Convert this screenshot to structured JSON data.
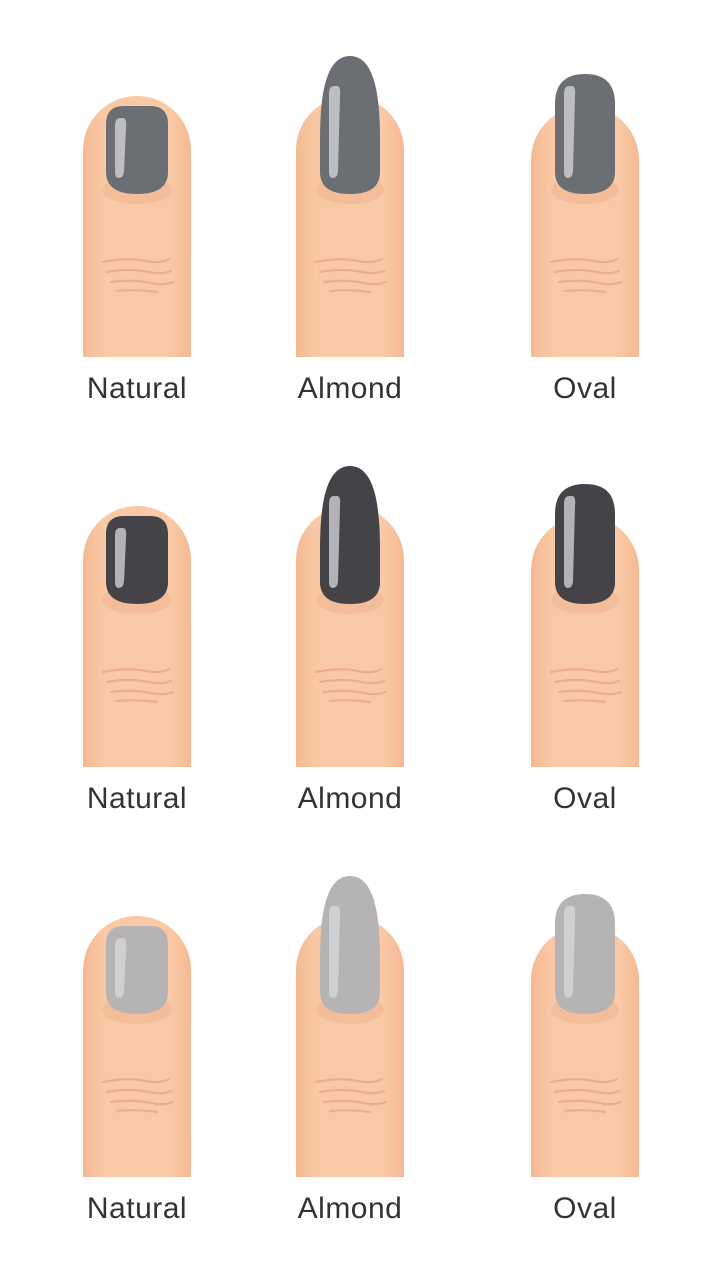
{
  "grid": [
    [
      {
        "label": "Natural",
        "shape": "natural",
        "polish": "#6b6e73"
      },
      {
        "label": "Almond",
        "shape": "almond",
        "polish": "#6b6e73"
      },
      {
        "label": "Oval",
        "shape": "oval",
        "polish": "#6b6e73"
      }
    ],
    [
      {
        "label": "Natural",
        "shape": "natural",
        "polish": "#444348"
      },
      {
        "label": "Almond",
        "shape": "almond",
        "polish": "#444348"
      },
      {
        "label": "Oval",
        "shape": "oval",
        "polish": "#444348"
      }
    ],
    [
      {
        "label": "Natural",
        "shape": "natural",
        "polish": "#b6b3b5"
      },
      {
        "label": "Almond",
        "shape": "almond",
        "polish": "#b6b3b5"
      },
      {
        "label": "Oval",
        "shape": "oval",
        "polish": "#b6b3b5"
      }
    ]
  ],
  "colors": {
    "skin": "#f9c8a4",
    "skin_shadow": "#f1b58f",
    "crease": "#e8a888",
    "highlight": "#d8d8dc",
    "label_text": "#333333"
  }
}
